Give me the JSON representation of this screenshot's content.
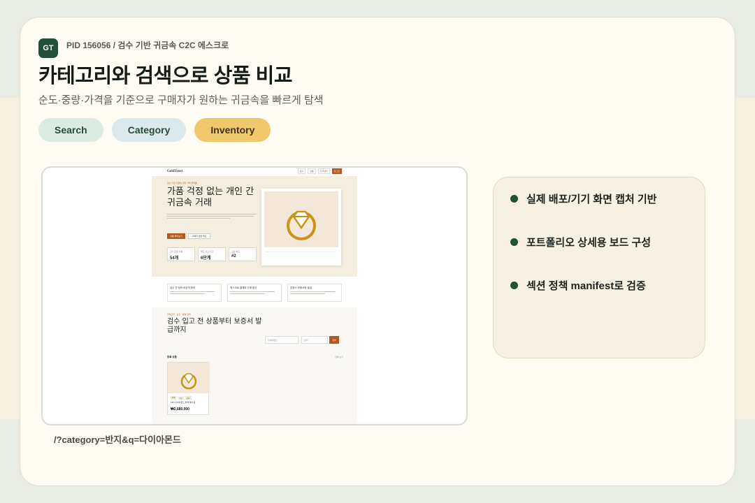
{
  "header": {
    "badge": "GT",
    "pid": "PID 156056 / 검수 기반 귀금속 C2C 에스크로",
    "title": "카테고리와 검색으로 상품 비교",
    "subtitle": "순도·중량·가격을 기준으로 구매자가 원하는 귀금속을 빠르게 탐색"
  },
  "chips": [
    {
      "label": "Search",
      "color": "#dcebe2"
    },
    {
      "label": "Category",
      "color": "#dce9ec"
    },
    {
      "label": "Inventory",
      "color": "#eec86a"
    }
  ],
  "screenshot": {
    "caption": "/?category=반지&q=다이아몬드",
    "site": {
      "logo": "GoldTrust",
      "nav": [
        "검수",
        "상품",
        "고객센터",
        "로그인"
      ],
      "hero": {
        "kicker": "검수 기반 귀금속 안전 거래 플랫폼",
        "title": "가품 걱정 없는 개인 간 귀금속 거래",
        "primary_button": "상품 둘러보기",
        "secondary_button": "구매자 보호 제도",
        "stats": [
          {
            "label": "검수 완료 상품",
            "value": "54개"
          },
          {
            "label": "평균 정산 기간",
            "value": "6단계"
          },
          {
            "label": "보증 등급",
            "value": "#2"
          }
        ]
      },
      "features": [
        "검수 전 정보 비공개 확보",
        "에스크로 결제와 단계 정산",
        "감정사 보증서와 발급"
      ],
      "section": {
        "kicker": "카테고리 · 순도 · 중량 검색",
        "title": "검수 입고 전 상품부터 보증서 발급까지",
        "search_placeholder": "다이아몬드",
        "select_value": "반지",
        "search_button": "검색",
        "list_title": "등록 상품",
        "list_more": "전체 보기",
        "product": {
          "tags": [
            "14K",
            "반지",
            "검수"
          ],
          "name": "14K 다이아몬드 솔리테어 링",
          "price": "₩2,680,000"
        }
      }
    }
  },
  "features": [
    "실제 배포/기기 화면 캡처 기반",
    "포트폴리오 상세용 보드 구성",
    "섹션 정책 manifest로 검증"
  ]
}
